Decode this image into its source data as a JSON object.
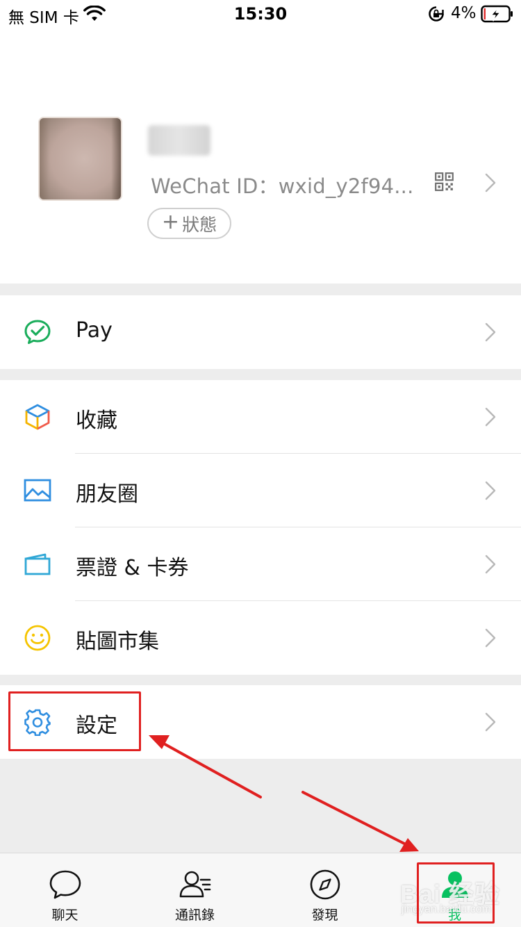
{
  "status_bar": {
    "carrier": "無 SIM 卡",
    "time": "15:30",
    "battery": "4%"
  },
  "profile": {
    "wechat_id": "WeChat ID：wxid_y2f94...",
    "status_button": "狀態",
    "status_plus": "+"
  },
  "menu": {
    "pay": "Pay",
    "favorites": "收藏",
    "moments": "朋友圈",
    "cards": "票證 & 卡券",
    "stickers": "貼圖市集",
    "settings": "設定"
  },
  "tabbar": {
    "chats": "聊天",
    "contacts": "通訊錄",
    "discover": "發現",
    "me": "我"
  },
  "watermark": {
    "text": "Bai 经验",
    "sub": "jingyan.baidu.com"
  },
  "colors": {
    "accent_green": "#07c160",
    "annotation_red": "#e02020",
    "icon_blue": "#2f8ee0",
    "icon_yellow": "#f5c400"
  },
  "icons": [
    "wifi-icon",
    "lock-rotation-icon",
    "battery-charging-icon",
    "qr-code-icon",
    "chevron-right-icon",
    "pay-icon",
    "favorites-cube-icon",
    "moments-image-icon",
    "cards-icon",
    "sticker-smile-icon",
    "settings-gear-icon",
    "chat-bubble-icon",
    "contacts-icon",
    "compass-icon",
    "me-person-icon"
  ]
}
